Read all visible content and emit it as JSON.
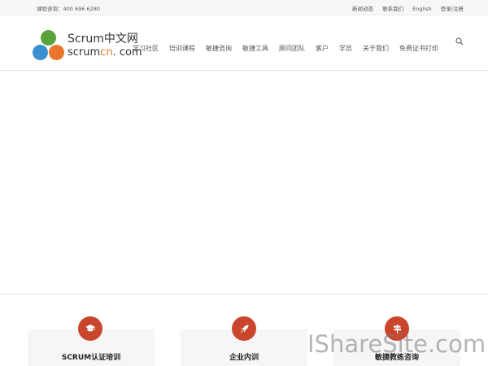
{
  "topbar": {
    "contact": "课程咨询：400 696 6280",
    "links": [
      "新闻动态",
      "联系我们",
      "English",
      "登录/注册"
    ]
  },
  "logo": {
    "title_cn": "Scrum中文网",
    "url_prefix": "scrum",
    "url_accent": "cn",
    "url_suffix": ". com"
  },
  "nav": {
    "items": [
      "学习社区",
      "培训课程",
      "敏捷咨询",
      "敏捷工具",
      "顾问团队",
      "客户",
      "学员",
      "关于我们",
      "免费证书打印"
    ],
    "search_icon": "search-icon"
  },
  "features": [
    {
      "title": "SCRUM认证培训",
      "icon": "graduation-cap-icon"
    },
    {
      "title": "企业内训",
      "icon": "rocket-icon"
    },
    {
      "title": "敏捷教练咨询",
      "icon": "signpost-icon"
    }
  ],
  "watermark": "IShareSite.com",
  "colors": {
    "accent": "#c9462c",
    "logo_green": "#5aa33c",
    "logo_blue": "#3a8fd1",
    "logo_orange": "#e8762d"
  }
}
